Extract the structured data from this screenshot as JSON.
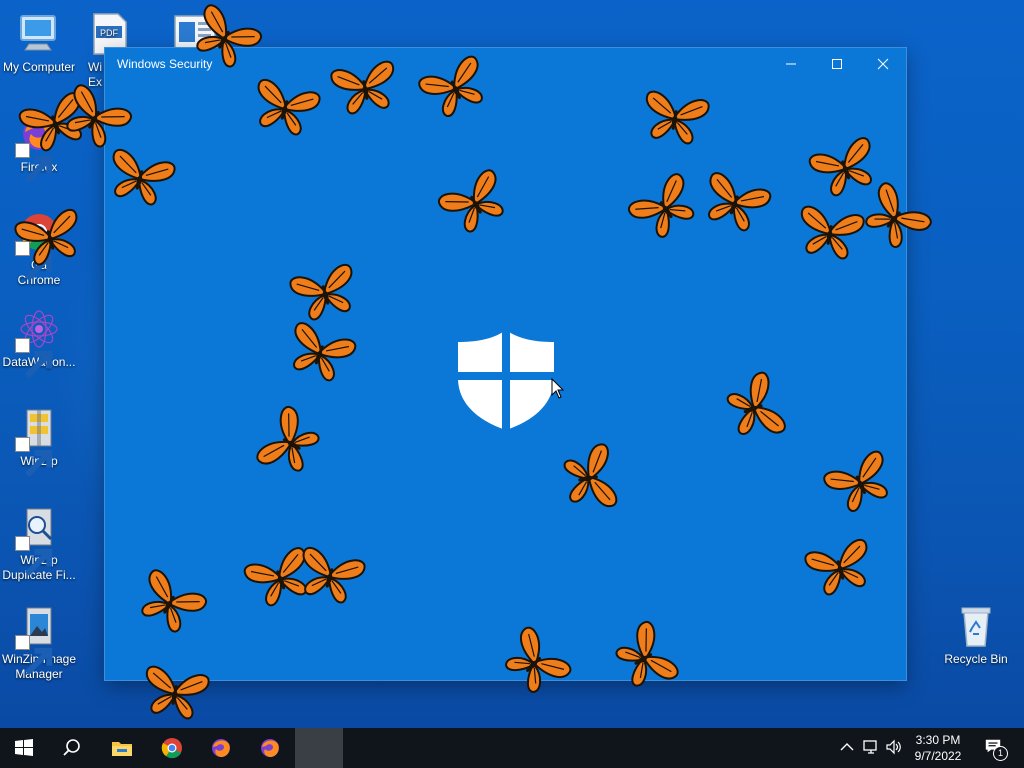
{
  "desktop": {
    "icons": [
      {
        "label": "My Computer"
      },
      {
        "label": "Wi\nEx"
      },
      {
        "label": ""
      },
      {
        "label": "Firefox"
      },
      {
        "label": "Ga\nChrome"
      },
      {
        "label": "DataWagon..."
      },
      {
        "label": "WinZip"
      },
      {
        "label": "WinZip\nDuplicate Fi..."
      },
      {
        "label": "WinZip Image\nManager"
      },
      {
        "label": "Recycle Bin"
      }
    ],
    "pdf_badge": "PDF"
  },
  "window": {
    "title": "Windows Security",
    "minimize_icon": "minimize-icon",
    "maximize_icon": "maximize-icon",
    "close_icon": "close-icon",
    "logo": "windows-defender-shield-icon",
    "overlay": "monarch-butterfly-animation",
    "colors": {
      "background": "#0b78d7",
      "butterfly_orange": "#ef7d1a",
      "butterfly_black": "#1b1208"
    }
  },
  "taskbar": {
    "apps": [
      {
        "name": "start-icon"
      },
      {
        "name": "search-icon"
      },
      {
        "name": "file-explorer-icon"
      },
      {
        "name": "chrome-icon"
      },
      {
        "name": "firefox-icon"
      },
      {
        "name": "firefox-icon"
      },
      {
        "name": "active-app-placeholder"
      }
    ],
    "tray": {
      "icons": [
        "chevron-up-icon",
        "network-icon",
        "volume-icon"
      ],
      "time": "3:30 PM",
      "date": "9/7/2022",
      "notification_count": "1"
    },
    "colors": {
      "background": "#10151c"
    }
  }
}
